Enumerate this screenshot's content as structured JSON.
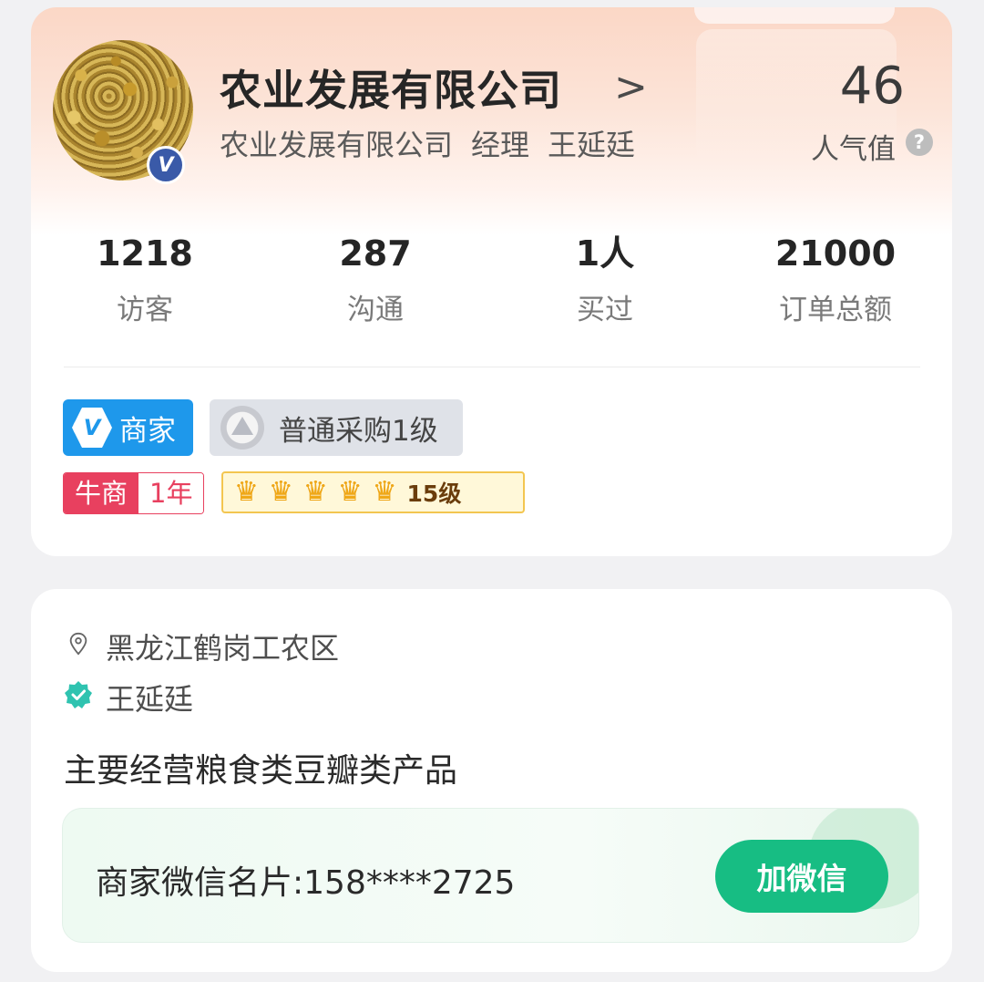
{
  "profile": {
    "company_name": "农业发展有限公司",
    "sub_company": "农业发展有限公司",
    "position": "经理",
    "person_name": "王延廷",
    "popularity_value": "46",
    "popularity_label": "人气值",
    "verified_badge": "V",
    "help_symbol": "?",
    "chevron": ">"
  },
  "stats": [
    {
      "value": "1218",
      "label": "访客"
    },
    {
      "value": "287",
      "label": "沟通"
    },
    {
      "value": "1人",
      "label": "买过"
    },
    {
      "value": "21000",
      "label": "订单总额"
    }
  ],
  "tags": {
    "merchant_icon": "V",
    "merchant": "商家",
    "buyer_level": "普通采购1级",
    "niu_label": "牛商",
    "niu_years": "1年",
    "crown_count": 5,
    "crown_level": "15级"
  },
  "info": {
    "location": "黑龙江鹤岗工农区",
    "verified_name": "王延廷",
    "description": "主要经营粮食类豆瓣类产品"
  },
  "wechat": {
    "label": "商家微信名片:158****2725",
    "button": "加微信"
  },
  "colors": {
    "header_gradient_top": "#fbd7c6",
    "merchant_blue": "#1e98eb",
    "niu_red": "#e8405f",
    "crown_gold": "#f0a816",
    "wechat_green": "#17bd83",
    "verify_teal": "#2fc3b0"
  }
}
